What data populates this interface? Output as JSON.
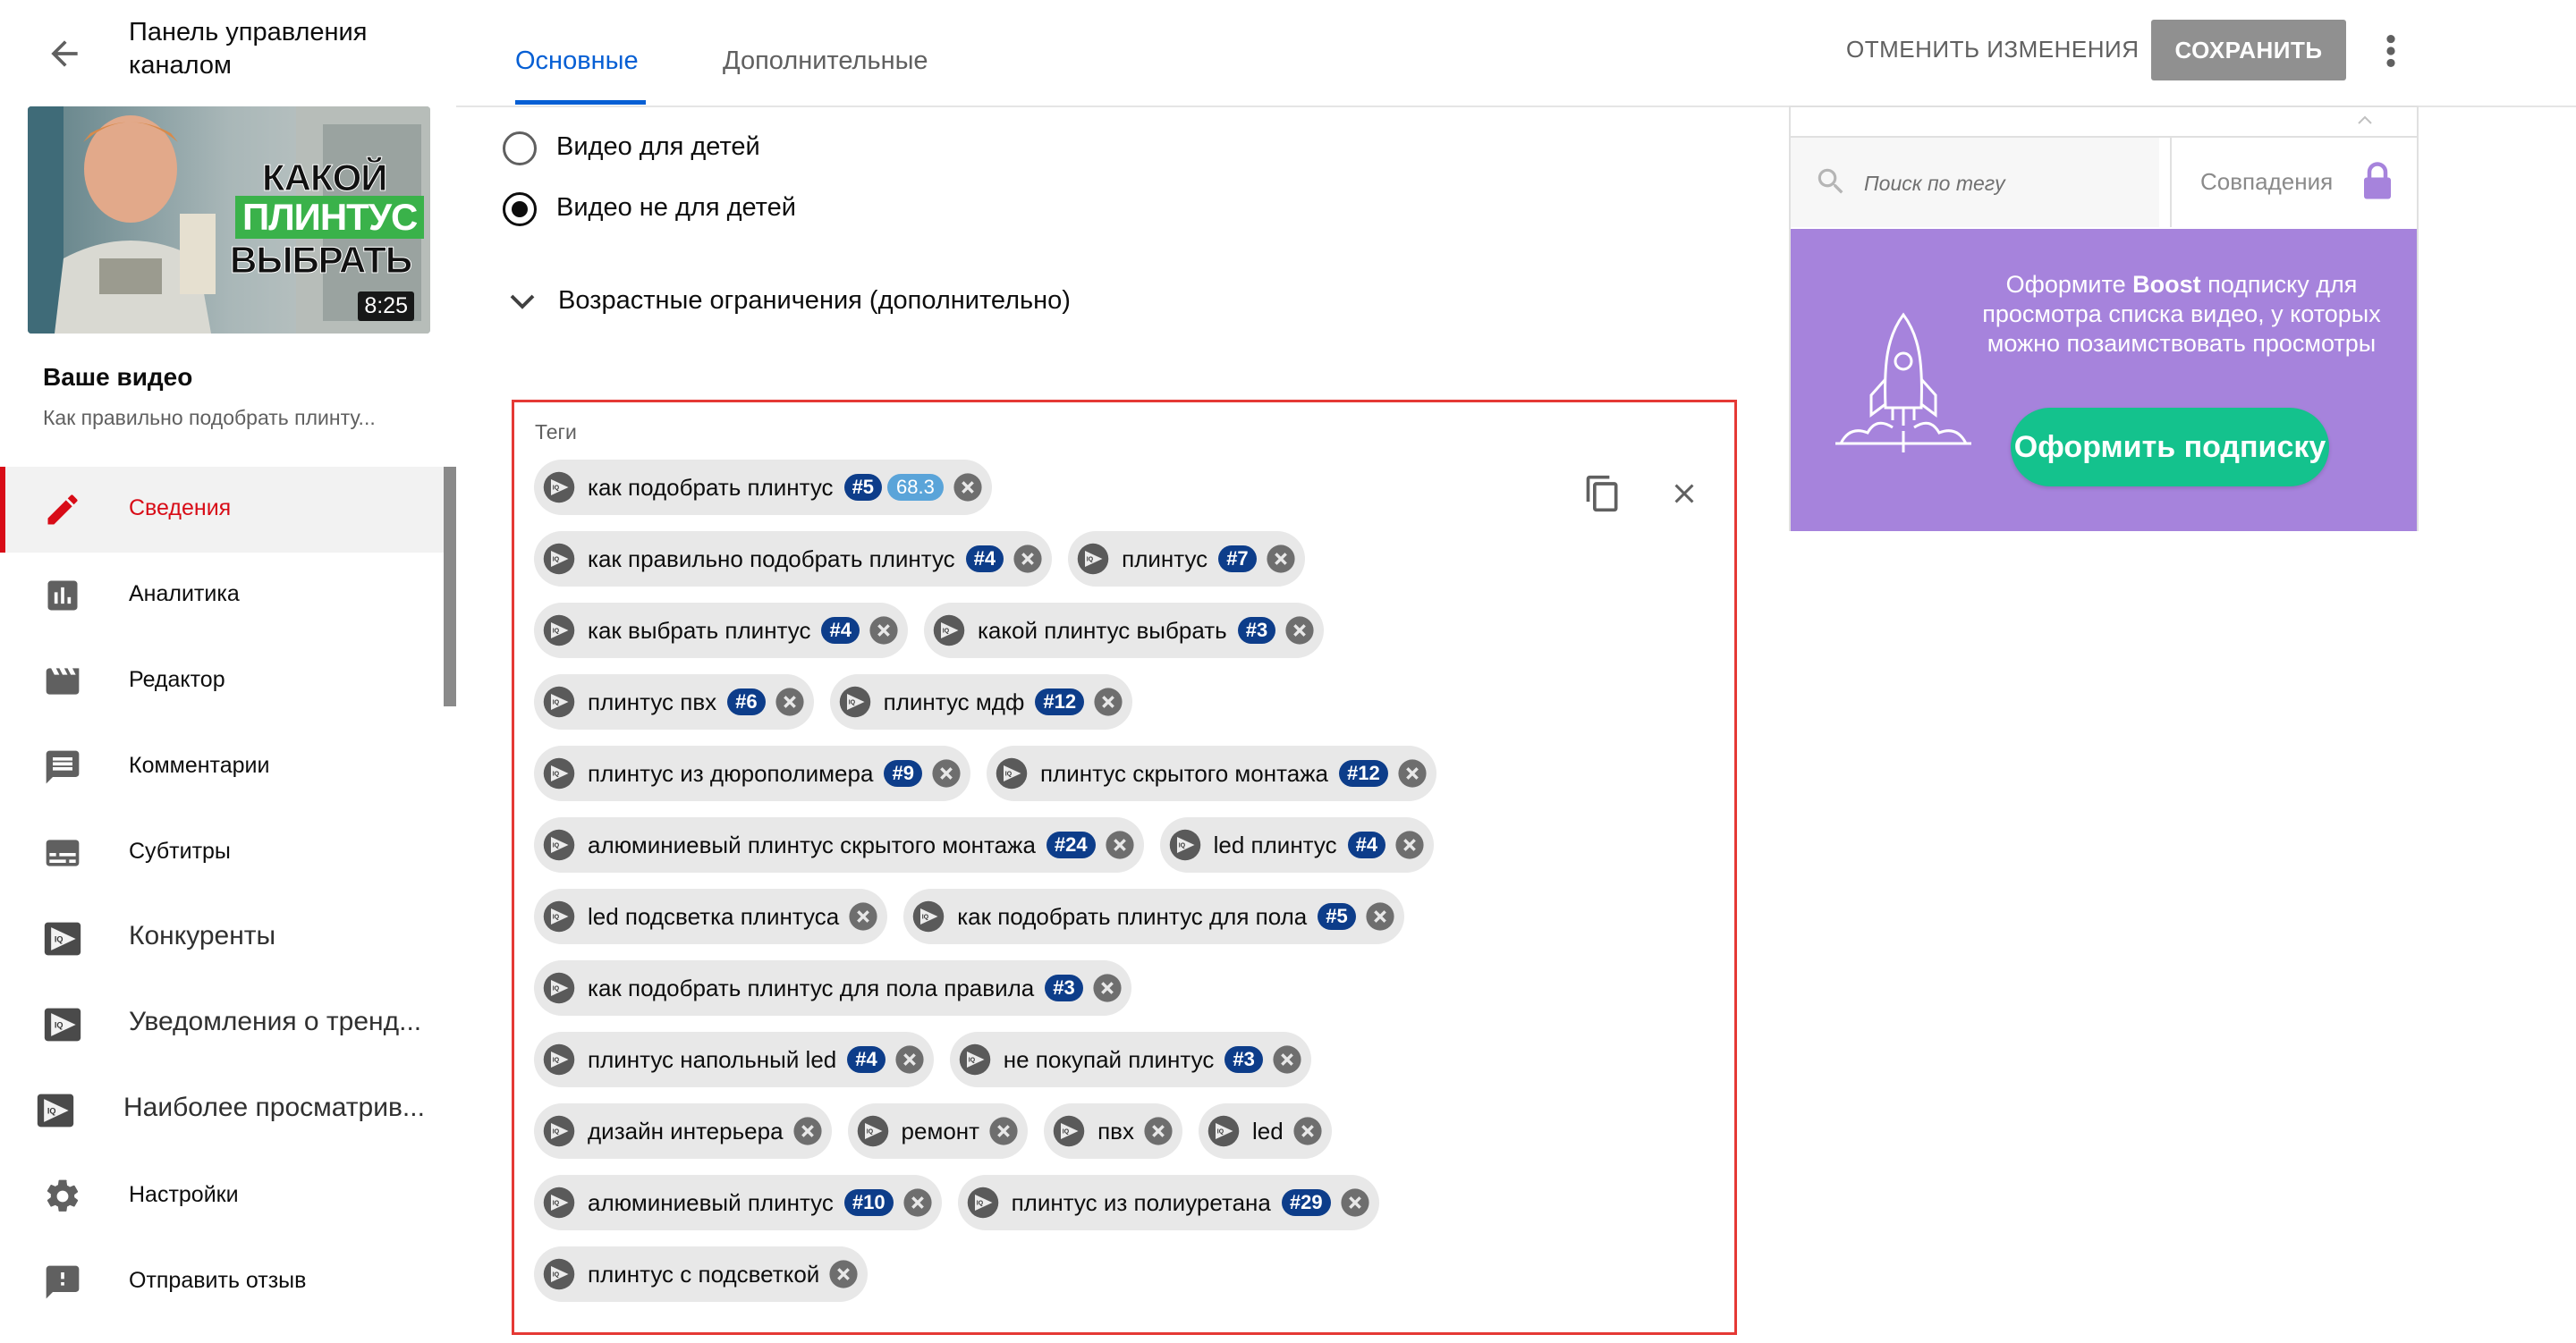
{
  "header": {
    "app_title_line1": "Панель управления",
    "app_title_line2": "каналом",
    "tabs": [
      "Основные",
      "Дополнительные"
    ],
    "undo_label": "ОТМЕНИТЬ ИЗМЕНЕНИЯ",
    "save_label": "СОХРАНИТЬ"
  },
  "sidebar": {
    "thumbnail_duration": "8:25",
    "your_video_label": "Ваше видео",
    "video_title": "Как правильно подобрать плинту...",
    "items": [
      {
        "label": "Сведения",
        "icon": "pencil-icon",
        "active": true
      },
      {
        "label": "Аналитика",
        "icon": "analytics-icon"
      },
      {
        "label": "Редактор",
        "icon": "clapperboard-icon"
      },
      {
        "label": "Комментарии",
        "icon": "comment-icon"
      },
      {
        "label": "Субтитры",
        "icon": "subtitles-icon"
      },
      {
        "label": "Конкуренты",
        "icon": "vidiq-icon"
      },
      {
        "label": "Уведомления о тренд...",
        "icon": "vidiq-icon"
      },
      {
        "label": "Наиболее просматрив...",
        "icon": "vidiq-icon"
      },
      {
        "label": "Настройки",
        "icon": "gear-icon"
      },
      {
        "label": "Отправить отзыв",
        "icon": "feedback-icon"
      }
    ]
  },
  "main": {
    "audience": {
      "option_kids": "Видео для детей",
      "option_not_kids": "Видео не для детей",
      "selected": "option_not_kids"
    },
    "age_restrictions_label": "Возрастные ограничения (дополнительно)",
    "tags_label": "Теги",
    "tag_rows": [
      [
        {
          "text": "как подобрать плинтус",
          "rank": "#5",
          "score": "68.3"
        }
      ],
      [
        {
          "text": "как правильно подобрать плинтус",
          "rank": "#4"
        },
        {
          "text": "плинтус",
          "rank": "#7"
        }
      ],
      [
        {
          "text": "как выбрать плинтус",
          "rank": "#4"
        },
        {
          "text": "какой плинтус выбрать",
          "rank": "#3"
        }
      ],
      [
        {
          "text": "плинтус пвх",
          "rank": "#6"
        },
        {
          "text": "плинтус мдф",
          "rank": "#12"
        }
      ],
      [
        {
          "text": "плинтус из дюрополимера",
          "rank": "#9"
        },
        {
          "text": "плинтус скрытого монтажа",
          "rank": "#12"
        }
      ],
      [
        {
          "text": "алюминиевый плинтус скрытого монтажа",
          "rank": "#24"
        },
        {
          "text": "led плинтус",
          "rank": "#4"
        }
      ],
      [
        {
          "text": "led подсветка плинтуса"
        },
        {
          "text": "как подобрать плинтус для пола",
          "rank": "#5"
        }
      ],
      [
        {
          "text": "как подобрать плинтус для пола правила",
          "rank": "#3"
        }
      ],
      [
        {
          "text": "плинтус напольный led",
          "rank": "#4"
        },
        {
          "text": "не покупай плинтус",
          "rank": "#3"
        }
      ],
      [
        {
          "text": "дизайн интерьера"
        },
        {
          "text": "ремонт"
        },
        {
          "text": "пвх"
        },
        {
          "text": "led"
        }
      ],
      [
        {
          "text": "алюминиевый плинтус",
          "rank": "#10"
        },
        {
          "text": "плинтус из полиуретана",
          "rank": "#29"
        }
      ],
      [
        {
          "text": "плинтус с подсветкой"
        }
      ]
    ]
  },
  "right_panel": {
    "search_placeholder": "Поиск по тегу",
    "match_label": "Совпадения",
    "boost_text_before": "Оформите ",
    "boost_text_bold": "Boost",
    "boost_text_after": " подписку для просмотра списка видео, у которых можно позаимствовать просмотры",
    "boost_button": "Оформить подписку"
  },
  "colors": {
    "accent_blue": "#065fd4",
    "active_red": "#d80c17",
    "highlight_border": "#e53935",
    "rank_badge": "#0d3d8a",
    "score_badge": "#5aa4d9",
    "boost_bg": "#a683dc",
    "boost_button": "#14c28d"
  }
}
